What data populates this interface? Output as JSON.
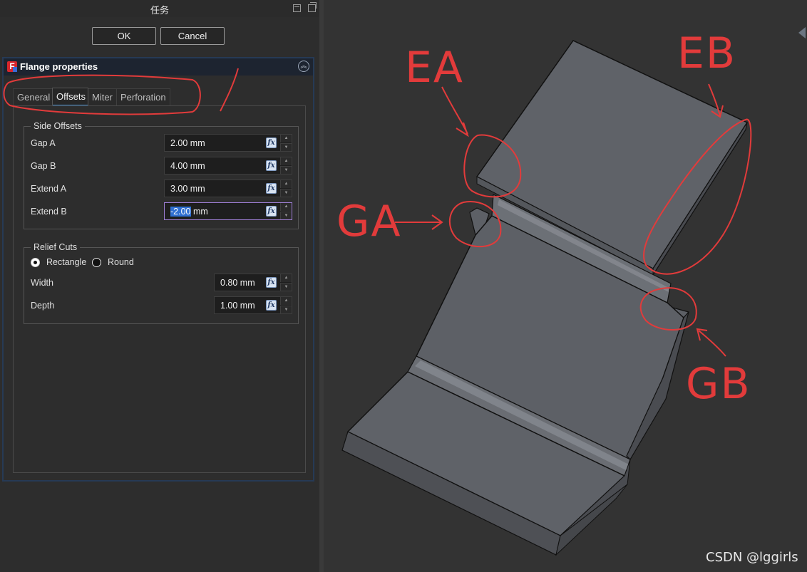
{
  "panel": {
    "title": "任务",
    "ok_label": "OK",
    "cancel_label": "Cancel",
    "box_title": "Flange properties",
    "logo_letter": "F",
    "tabs": [
      {
        "label": "General"
      },
      {
        "label": "Offsets"
      },
      {
        "label": "Miter"
      },
      {
        "label": "Perforation"
      }
    ],
    "active_tab": "Offsets",
    "side_offsets": {
      "title": "Side Offsets",
      "rows": [
        {
          "label": "Gap A",
          "value": "2.00 mm"
        },
        {
          "label": "Gap B",
          "value": "4.00 mm"
        },
        {
          "label": "Extend A",
          "value": "3.00 mm"
        },
        {
          "label": "Extend B",
          "value_selected": "-2.00",
          "value_unit": " mm"
        }
      ]
    },
    "relief_cuts": {
      "title": "Relief Cuts",
      "shape_options": [
        {
          "label": "Rectangle",
          "selected": true
        },
        {
          "label": "Round",
          "selected": false
        }
      ],
      "rows": [
        {
          "label": "Width",
          "value": "0.80 mm"
        },
        {
          "label": "Depth",
          "value": "1.00 mm"
        }
      ]
    },
    "fx_label": "fx"
  },
  "viewport": {
    "annotations": {
      "ea": "EA",
      "eb": "EB",
      "ga": "GA",
      "gb": "GB"
    },
    "watermark": "CSDN @lggirls"
  },
  "colors": {
    "accent_tab": "#3f86c7",
    "annotation_red": "#e23b3b",
    "selection": "#2f6fd2",
    "model_face": "#5f6268"
  }
}
